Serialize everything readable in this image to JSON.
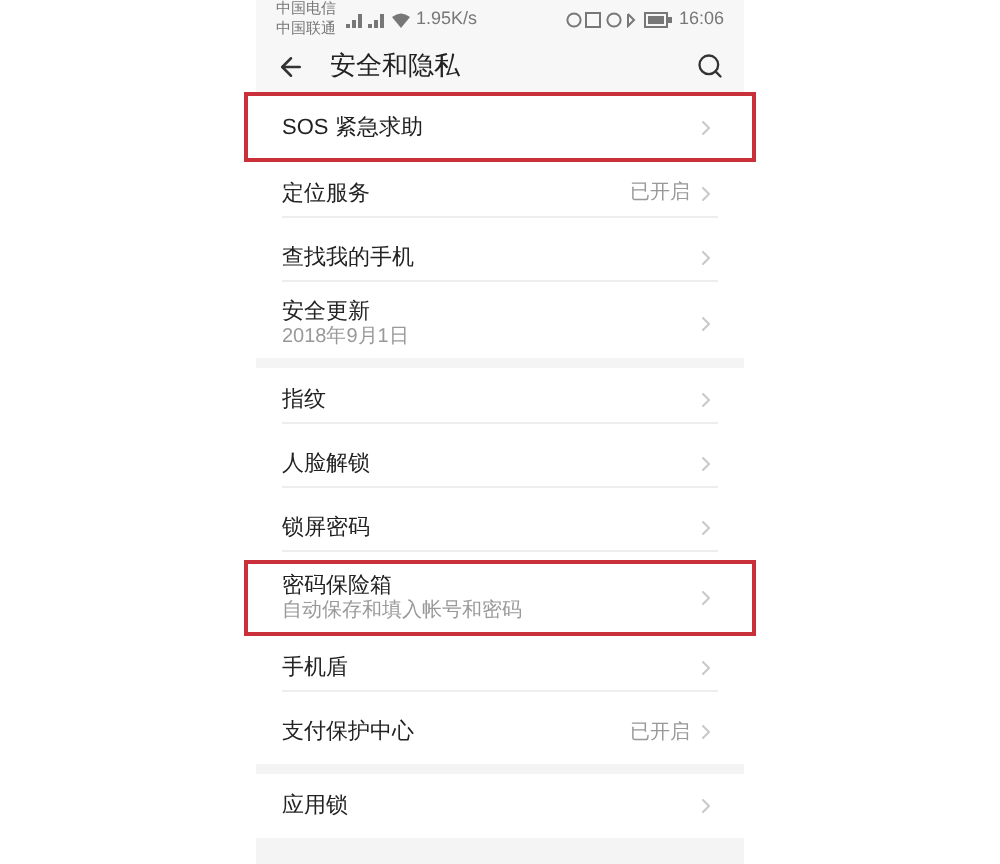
{
  "status_bar": {
    "carriers": [
      "中国电信",
      "中国联通"
    ],
    "speed": "1.95K/s",
    "time": "16:06"
  },
  "header": {
    "title": "安全和隐私"
  },
  "sections": [
    {
      "items": [
        {
          "title": "SOS 紧急求助",
          "highlighted": true
        },
        {
          "title": "定位服务",
          "value": "已开启",
          "highlighted": false
        },
        {
          "title": "查找我的手机",
          "highlighted": false
        },
        {
          "title": "安全更新",
          "subtitle": "2018年9月1日",
          "highlighted": false
        }
      ]
    },
    {
      "items": [
        {
          "title": "指纹",
          "highlighted": false
        },
        {
          "title": "人脸解锁",
          "highlighted": false
        },
        {
          "title": "锁屏密码",
          "highlighted": false
        },
        {
          "title": "密码保险箱",
          "subtitle": "自动保存和填入帐号和密码",
          "highlighted": true
        },
        {
          "title": "手机盾",
          "highlighted": false
        },
        {
          "title": "支付保护中心",
          "value": "已开启",
          "highlighted": false
        }
      ]
    },
    {
      "items": [
        {
          "title": "应用锁",
          "highlighted": false
        }
      ]
    }
  ]
}
